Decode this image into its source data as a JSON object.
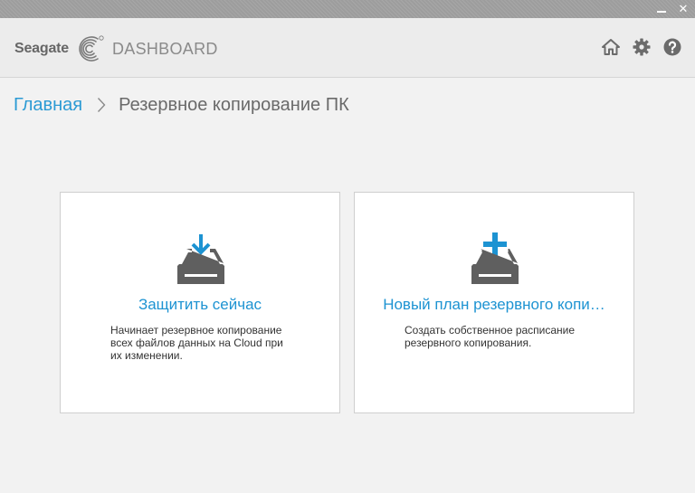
{
  "window": {
    "minimize_label": "_",
    "close_label": "✕"
  },
  "header": {
    "brand": "Seagate",
    "product": "DASHBOARD",
    "icons": [
      "home-icon",
      "gear-icon",
      "help-icon"
    ]
  },
  "breadcrumb": {
    "home": "Главная",
    "current": "Резервное копирование ПК"
  },
  "cards": [
    {
      "icon": "download-tray-icon",
      "title": "Защитить сейчас",
      "description": "Начинает резервное копирование всех файлов данных на Cloud при их изменении."
    },
    {
      "icon": "add-tray-icon",
      "title": "Новый план резервного копи…",
      "description": "Создать собственное расписание резервного копирования."
    }
  ],
  "colors": {
    "accent": "#1d93d2",
    "icon_gray": "#5f5f5f",
    "background": "#f2f2f2"
  }
}
